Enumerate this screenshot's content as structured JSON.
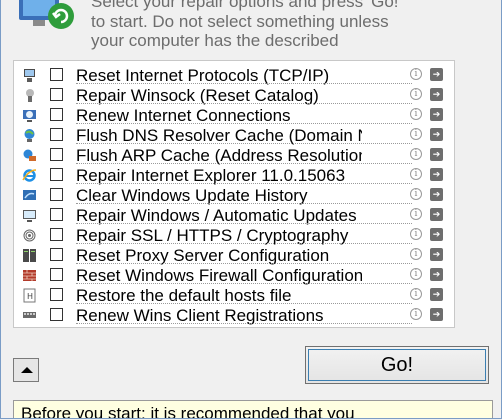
{
  "intro": {
    "line1": "Select your repair options and press 'Go!'",
    "line2": "to start. Do not select something unless",
    "line3": "your computer has the described"
  },
  "repairs": [
    {
      "label": "Reset Internet Protocols (TCP/IP)",
      "icon": "network-adapter-icon",
      "checked": false
    },
    {
      "label": "Repair Winsock (Reset Catalog)",
      "icon": "winsock-icon",
      "checked": false
    },
    {
      "label": "Renew Internet Connections",
      "icon": "globe-monitor-icon",
      "checked": false
    },
    {
      "label": "Flush DNS Resolver Cache (Domain Name System)",
      "icon": "dns-globe-icon",
      "checked": false
    },
    {
      "label": "Flush ARP Cache (Address Resolution Protocol)",
      "icon": "arp-network-icon",
      "checked": false
    },
    {
      "label": "Repair Internet Explorer 11.0.15063",
      "icon": "internet-explorer-icon",
      "checked": false
    },
    {
      "label": "Clear Windows Update History",
      "icon": "update-history-icon",
      "checked": false
    },
    {
      "label": "Repair Windows / Automatic Updates",
      "icon": "windows-update-icon",
      "checked": false
    },
    {
      "label": "Repair SSL / HTTPS / Cryptography",
      "icon": "fingerprint-ssl-icon",
      "checked": false
    },
    {
      "label": "Reset Proxy Server Configuration",
      "icon": "proxy-server-icon",
      "checked": false
    },
    {
      "label": "Reset Windows Firewall Configuration",
      "icon": "firewall-icon",
      "checked": false
    },
    {
      "label": "Restore the default hosts file",
      "icon": "hosts-file-icon",
      "checked": false
    },
    {
      "label": "Renew Wins Client Registrations",
      "icon": "wins-client-icon",
      "checked": false
    }
  ],
  "info_glyph": "i",
  "arrow_glyph": "➔",
  "go_button": "Go!",
  "notice": "Before you start: it is recommended that you"
}
